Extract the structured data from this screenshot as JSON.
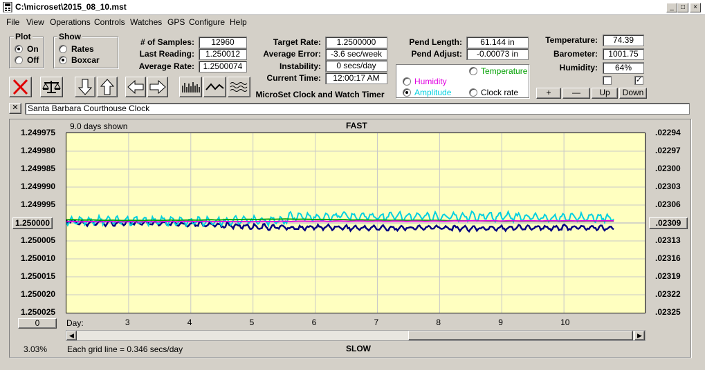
{
  "window": {
    "title": "C:\\microset\\2015_08_10.mst",
    "minimize": "_",
    "maximize": "□",
    "close": "×"
  },
  "menu": [
    "File",
    "View",
    "Operations",
    "Controls",
    "Watches",
    "GPS",
    "Configure",
    "Help"
  ],
  "plot_group": {
    "label": "Plot",
    "on": "On",
    "off": "Off",
    "selected": "On"
  },
  "show_group": {
    "label": "Show",
    "rates": "Rates",
    "boxcar": "Boxcar",
    "selected": "Boxcar"
  },
  "stats": {
    "samples_label": "# of Samples:",
    "samples": "12960",
    "last_label": "Last Reading:",
    "last": "1.250012",
    "avg_label": "Average Rate:",
    "avg": "1.2500074",
    "target_label": "Target Rate:",
    "target": "1.2500000",
    "avgerr_label": "Average Error:",
    "avgerr": "-3.6 sec/week",
    "instab_label": "Instability:",
    "instab": "0 secs/day",
    "time_label": "Current Time:",
    "time": "12:00:17 AM",
    "app_caption": "MicroSet Clock and Watch Timer",
    "pendlen_label": "Pend Length:",
    "pendlen": "61.144 in",
    "pendadj_label": "Pend Adjust:",
    "pendadj": "-0.00073 in",
    "temp_label": "Temperature:",
    "temp": "74.39",
    "baro_label": "Barometer:",
    "baro": "1001.75",
    "humid_label": "Humidity:",
    "humid": "64%"
  },
  "overlay": {
    "temperature": "Temperature",
    "humidity": "Humidity",
    "amplitude": "Amplitude",
    "clockrate": "Clock rate",
    "selected": "Amplitude",
    "colors": {
      "temperature": "#00a000",
      "humidity": "#e000e0",
      "amplitude": "#00d0e0"
    }
  },
  "small_buttons": {
    "plus": "+",
    "minus": "—",
    "up": "Up",
    "down": "Down"
  },
  "clock_name": "Santa Barbara Courthouse Clock",
  "close_x": "✕",
  "chart_header": {
    "days_shown": "9.0 days shown",
    "fast": "FAST",
    "slow": "SLOW",
    "day_label": "Day:",
    "grid_note": "Each grid line = 0.346 secs/day",
    "percent": "3.03%"
  },
  "left_button": "1.250000",
  "right_button": ".02309",
  "zero_button": "0",
  "chart_data": {
    "type": "line",
    "x_range": [
      2,
      11.3
    ],
    "x_ticks": [
      "3",
      "4",
      "5",
      "6",
      "7",
      "8",
      "9",
      "10"
    ],
    "y_left_ticks": [
      "1.249975",
      "1.249980",
      "1.249985",
      "1.249990",
      "1.249995",
      "1.250000",
      "1.250005",
      "1.250010",
      "1.250015",
      "1.250020",
      "1.250025"
    ],
    "y_right_ticks": [
      ".02294",
      ".02297",
      ".02300",
      ".02303",
      ".02306",
      ".02309",
      ".02313",
      ".02316",
      ".02319",
      ".02322",
      ".02325"
    ],
    "y_range": [
      1.249975,
      1.250025
    ],
    "grid": true,
    "series": [
      {
        "name": "rate",
        "color": "#000080",
        "x": [
          2.0,
          2.3,
          2.6,
          3.0,
          3.4,
          3.8,
          4.2,
          4.6,
          5.0,
          5.3,
          5.5,
          5.6,
          6.0,
          6.4,
          6.6,
          7.0,
          7.5,
          8.0,
          8.5,
          8.7,
          9.0,
          9.5,
          10.0,
          10.5,
          10.8
        ],
        "y": [
          1.2499995,
          1.25,
          1.25,
          1.25,
          1.2500002,
          1.2500003,
          1.2500004,
          1.2500007,
          1.250001,
          1.2500012,
          1.2500011,
          1.2500014,
          1.2500012,
          1.2500012,
          1.2500014,
          1.2500014,
          1.2500014,
          1.2500013,
          1.2500015,
          1.2500014,
          1.2500013,
          1.2500013,
          1.2500013,
          1.2500013,
          1.2500014
        ]
      },
      {
        "name": "Amplitude",
        "color": "#00d0e0",
        "x": [
          2.0,
          2.5,
          3.0,
          3.5,
          4.0,
          4.5,
          5.0,
          5.3,
          5.5,
          5.6,
          6.0,
          6.5,
          7.0,
          7.5,
          8.0,
          8.5,
          9.0,
          9.5,
          10.0,
          10.5,
          10.8
        ],
        "y": [
          1.2499995,
          1.2499992,
          1.2499993,
          1.2499994,
          1.2499995,
          1.2499994,
          1.2499994,
          1.2499995,
          1.2499993,
          1.2499982,
          1.2499983,
          1.249998,
          1.2499982,
          1.2499983,
          1.2499983,
          1.2499981,
          1.2499982,
          1.2499984,
          1.2499985,
          1.2499984,
          1.2499986
        ]
      },
      {
        "name": "Temperature",
        "color": "#00a000",
        "x": [
          2.0,
          3.0,
          4.0,
          5.0,
          5.5,
          6.0,
          7.0,
          8.0,
          9.0,
          10.0,
          10.8
        ],
        "y": [
          1.2499991,
          1.2499993,
          1.2499992,
          1.249999,
          1.2499989,
          1.249999,
          1.2499992,
          1.2499993,
          1.2499995,
          1.2499995,
          1.2499995
        ]
      },
      {
        "name": "Humidity",
        "color": "#e000e0",
        "x": [
          2.0,
          3.0,
          4.0,
          5.0,
          6.0,
          7.0,
          8.0,
          8.5,
          9.0,
          10.0,
          10.8
        ],
        "y": [
          1.2499996,
          1.2499997,
          1.2499996,
          1.2499996,
          1.2499995,
          1.2499995,
          1.2499995,
          1.2499994,
          1.2499994,
          1.2499994,
          1.2499994
        ]
      }
    ]
  }
}
